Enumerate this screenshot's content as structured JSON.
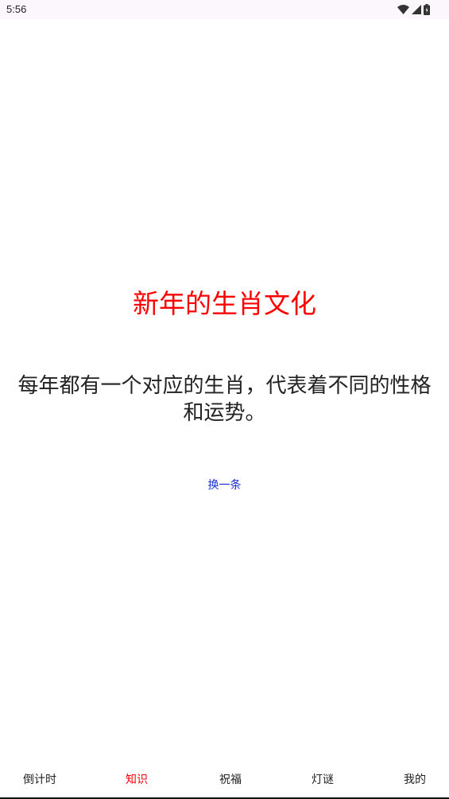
{
  "status_bar": {
    "time": "5:56",
    "icons": [
      "wifi-icon",
      "signal-icon",
      "battery-icon"
    ]
  },
  "content": {
    "title": "新年的生肖文化",
    "body": "每年都有一个对应的生肖，代表着不同的性格和运势。",
    "refresh_label": "换一条"
  },
  "colors": {
    "accent": "#ff0000",
    "link": "#1a2fd8",
    "text": "#222222"
  },
  "bottom_nav": {
    "items": [
      {
        "label": "倒计时"
      },
      {
        "label": "知识"
      },
      {
        "label": "祝福"
      },
      {
        "label": "灯谜"
      },
      {
        "label": "我的"
      }
    ],
    "active": "知识"
  }
}
